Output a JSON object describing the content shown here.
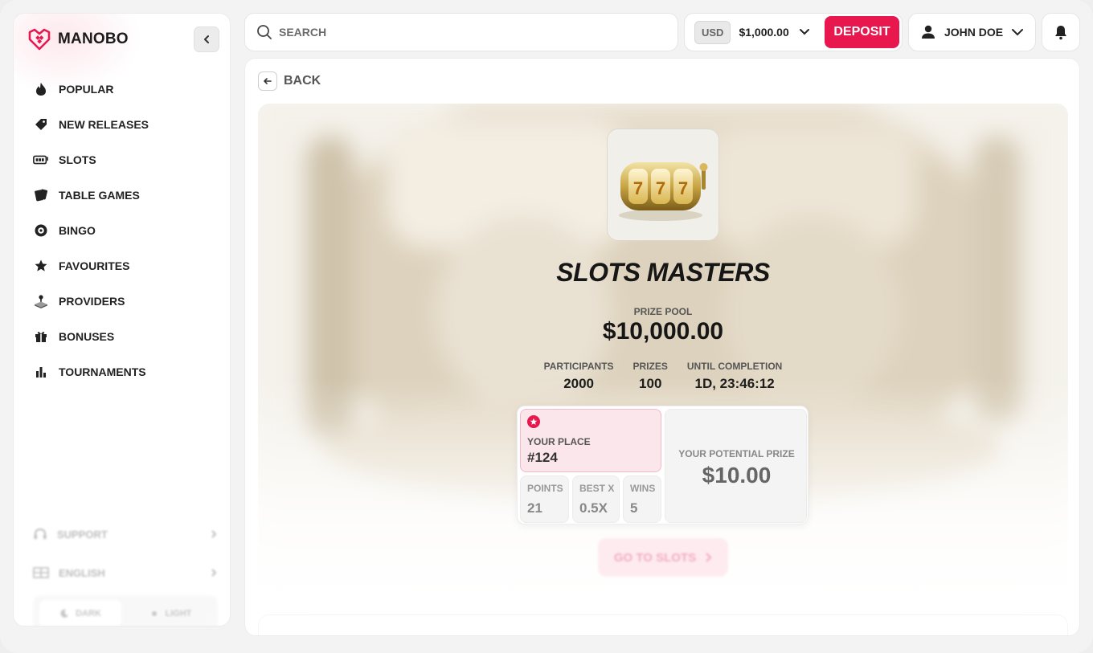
{
  "brand": {
    "name": "MANOBO",
    "accent": "#e8174e"
  },
  "sidebar": {
    "items": [
      {
        "label": "POPULAR",
        "icon": "fire-icon"
      },
      {
        "label": "NEW RELEASES",
        "icon": "tag-icon"
      },
      {
        "label": "SLOTS",
        "icon": "slot-machine-icon"
      },
      {
        "label": "TABLE GAMES",
        "icon": "cards-icon"
      },
      {
        "label": "BINGO",
        "icon": "bingo-ball-icon"
      },
      {
        "label": "FAVOURITES",
        "icon": "star-icon"
      },
      {
        "label": "PROVIDERS",
        "icon": "joystick-icon"
      },
      {
        "label": "BONUSES",
        "icon": "gift-icon"
      },
      {
        "label": "TOURNAMENTS",
        "icon": "bar-chart-icon"
      }
    ],
    "support_label": "SUPPORT",
    "language_label": "ENGLISH",
    "theme": {
      "dark_label": "DARK",
      "light_label": "LIGHT"
    }
  },
  "header": {
    "search_placeholder": "SEARCH",
    "currency": "USD",
    "balance": "$1,000.00",
    "deposit_label": "DEPOSIT",
    "user_name": "JOHN DOE"
  },
  "main": {
    "back_label": "BACK",
    "tournament": {
      "title": "SLOTS MASTERS",
      "prize_pool_label": "PRIZE POOL",
      "prize_pool": "$10,000.00",
      "stats": [
        {
          "label": "PARTICIPANTS",
          "value": "2000"
        },
        {
          "label": "PRIZES",
          "value": "100"
        },
        {
          "label": "UNTIL COMPLETION",
          "value": "1D, 23:46:12"
        }
      ],
      "your_place_label": "YOUR PLACE",
      "your_place": "#124",
      "mini_stats": [
        {
          "label": "POINTS",
          "value": "21"
        },
        {
          "label": "BEST X",
          "value": "0.5X"
        },
        {
          "label": "WINS",
          "value": "5"
        }
      ],
      "potential_prize_label": "YOUR POTENTIAL PRIZE",
      "potential_prize": "$10.00",
      "cta_label": "GO TO SLOTS"
    }
  }
}
